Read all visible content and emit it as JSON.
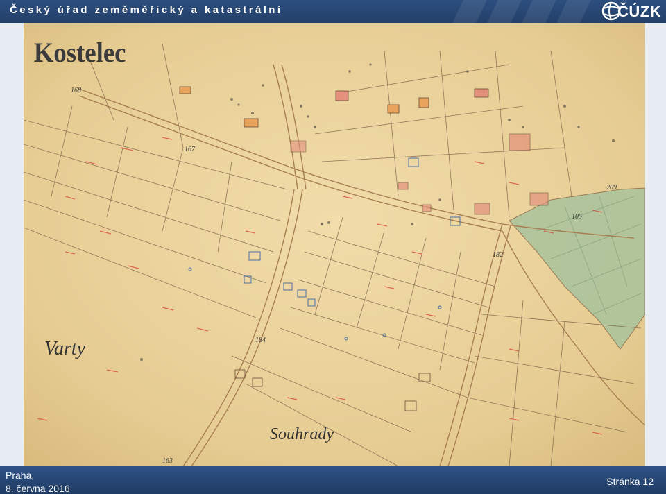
{
  "header": {
    "title": "Český úřad zeměměřický a katastrální",
    "logo_text": "ČÚZK"
  },
  "map": {
    "labels": {
      "locality_1": "Kostelec",
      "locality_2": "Varty",
      "locality_3": "Souhrady"
    },
    "parcel_numbers": [
      "168",
      "167",
      "182",
      "184",
      "209",
      "105",
      "163"
    ]
  },
  "footer": {
    "place": "Praha,",
    "date": "8. června 2016",
    "page": "Stránka 12"
  },
  "colors": {
    "header_bg": "#2d4f7f",
    "footer_bg": "#1f3b62",
    "map_paper": "#e8cf97",
    "meadow_green": "#a8c29a",
    "parcel_numbers": "#d7433a"
  }
}
